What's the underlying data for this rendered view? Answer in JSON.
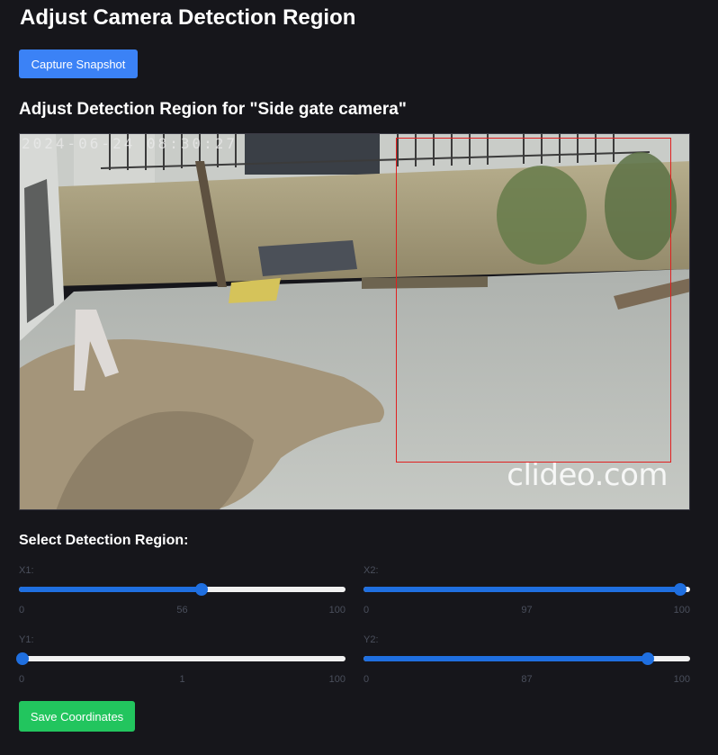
{
  "page": {
    "title": "Adjust Camera Detection Region"
  },
  "toolbar": {
    "capture_label": "Capture Snapshot"
  },
  "camera": {
    "heading": "Adjust Detection Region for \"Side gate camera\"",
    "timestamp": "2024-06-24 08:30:27",
    "watermark": "clideo.com",
    "region_color": "#e02020"
  },
  "region_form": {
    "heading": "Select Detection Region:",
    "sliders": {
      "x1": {
        "label": "X1:",
        "min": "0",
        "max": "100",
        "value": "56"
      },
      "x2": {
        "label": "X2:",
        "min": "0",
        "max": "100",
        "value": "97"
      },
      "y1": {
        "label": "Y1:",
        "min": "0",
        "max": "100",
        "value": "1"
      },
      "y2": {
        "label": "Y2:",
        "min": "0",
        "max": "100",
        "value": "87"
      }
    },
    "save_label": "Save Coordinates"
  },
  "colors": {
    "accent": "#3b82f6",
    "slider": "#1f6fe0",
    "save": "#22c55e",
    "background": "#16161b"
  }
}
